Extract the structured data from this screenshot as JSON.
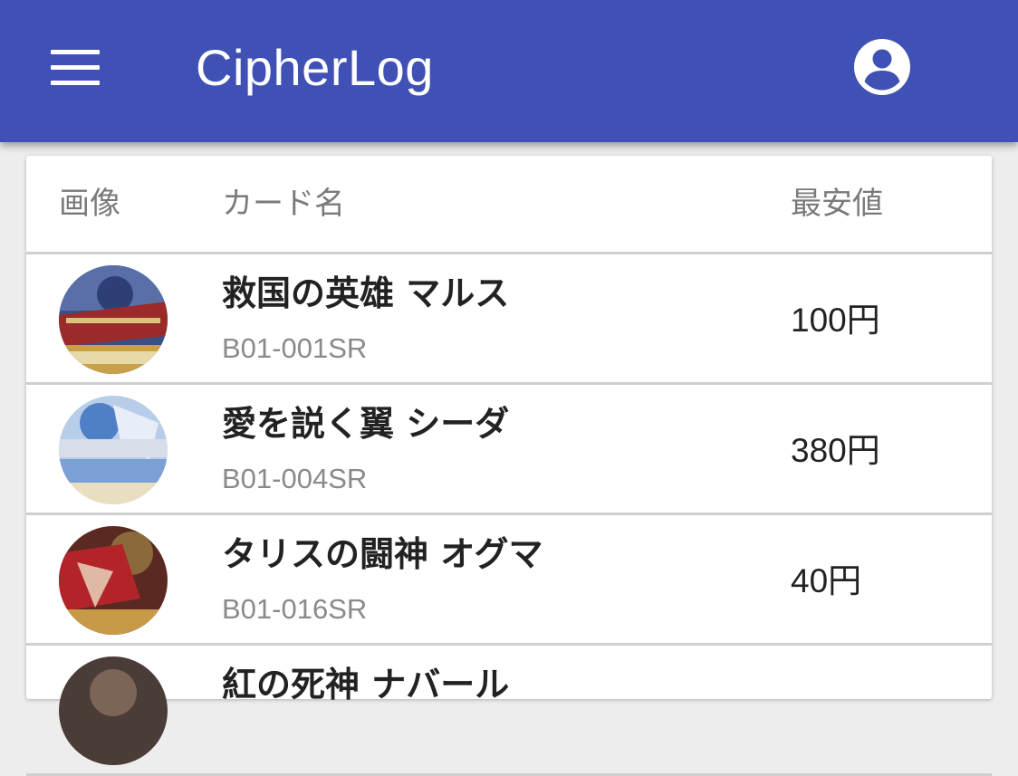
{
  "app_bar": {
    "title": "CipherLog",
    "menu_icon": "hamburger-menu-icon",
    "account_icon": "account-circle-icon",
    "background_color": "#3f51b5"
  },
  "table": {
    "headers": {
      "image": "画像",
      "name": "カード名",
      "price": "最安値"
    },
    "rows": [
      {
        "name": "救国の英雄 マルス",
        "code": "B01-001SR",
        "price": "100円"
      },
      {
        "name": "愛を説く翼 シーダ",
        "code": "B01-004SR",
        "price": "380円"
      },
      {
        "name": "タリスの闘神 オグマ",
        "code": "B01-016SR",
        "price": "40円"
      },
      {
        "name": "紅の死神 ナバール",
        "code": "",
        "price": ""
      }
    ]
  }
}
